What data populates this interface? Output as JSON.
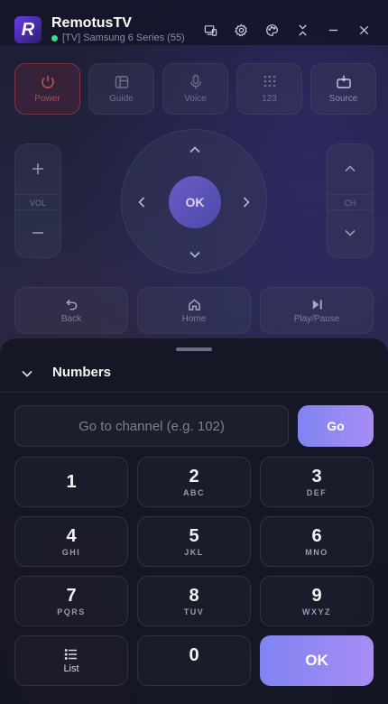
{
  "app": {
    "title": "RemotusTV",
    "logo_letter": "R",
    "device": "[TV] Samsung 6 Series (55)",
    "status_color": "#3ddc84"
  },
  "window_controls": [
    "cast-device-icon",
    "gear-icon",
    "palette-icon",
    "collapse-arrows-icon",
    "minimize-icon",
    "close-icon"
  ],
  "top_buttons": {
    "power": "Power",
    "guide": "Guide",
    "voice": "Voice",
    "numbers": "123",
    "source": "Source"
  },
  "rockers": {
    "vol_label": "VOL",
    "ch_label": "CH"
  },
  "dpad": {
    "ok": "OK"
  },
  "playback": {
    "back": "Back",
    "home": "Home",
    "play_pause": "Play/Pause"
  },
  "sheet": {
    "title": "Numbers",
    "channel_placeholder": "Go to channel (e.g. 102)",
    "channel_value": "",
    "go_label": "Go"
  },
  "keypad": {
    "k1": {
      "digit": "1",
      "letters": ""
    },
    "k2": {
      "digit": "2",
      "letters": "ABC"
    },
    "k3": {
      "digit": "3",
      "letters": "DEF"
    },
    "k4": {
      "digit": "4",
      "letters": "GHI"
    },
    "k5": {
      "digit": "5",
      "letters": "JKL"
    },
    "k6": {
      "digit": "6",
      "letters": "MNO"
    },
    "k7": {
      "digit": "7",
      "letters": "PQRS"
    },
    "k8": {
      "digit": "8",
      "letters": "TUV"
    },
    "k9": {
      "digit": "9",
      "letters": "WXYZ"
    },
    "list_label": "List",
    "k0": {
      "digit": "0"
    },
    "ok_label": "OK"
  },
  "colors": {
    "accent_start": "#7f84f2",
    "accent_end": "#a98cf4",
    "power_accent": "#a05060"
  }
}
